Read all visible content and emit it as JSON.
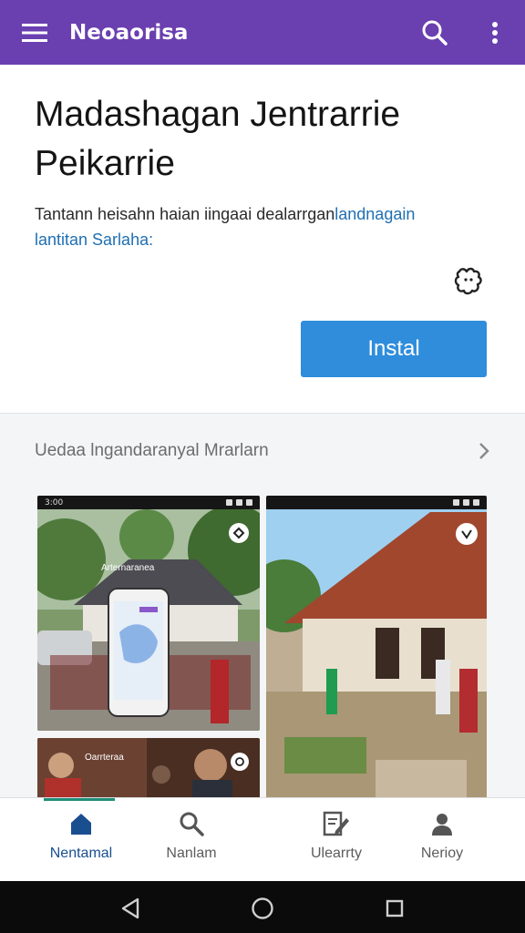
{
  "app_bar": {
    "title": "Neoaorisa",
    "menu_icon": "menu-icon",
    "search_icon": "search-icon",
    "more_icon": "more-vert-icon",
    "color": "#6a3fb0"
  },
  "hero": {
    "title": "Madashagan Jentrarrie Peikarrie",
    "description_text": "Tantann heisahn haian iingaai dealarrgan",
    "description_link": "landnagain lantitan Sarlaha:",
    "badge_icon": "puzzle-badge-icon",
    "install_label": "Instal",
    "install_color": "#2f8ddc"
  },
  "section": {
    "title": "Uedaa lngandaranyal Mrarlarn",
    "chevron_icon": "chevron-right-icon"
  },
  "screenshots": [
    {
      "label": "village-gathering-phone-screenshot",
      "status_time": "3:00",
      "overlay_sign": "Arternaranea",
      "badge_icon": "nfc-icon"
    },
    {
      "label": "village-house-market-screenshot",
      "badge_icon": "shield-check-icon"
    },
    {
      "label": "people-portraits-screenshot",
      "overlay_sign": "Oarrteraa",
      "badge_icon": "share-icon"
    }
  ],
  "bottom_nav": {
    "indicator_color": "#1e8f78",
    "items": [
      {
        "label": "Nentamal",
        "icon": "home-icon",
        "active": true
      },
      {
        "label": "Nanlam",
        "icon": "search-icon",
        "active": false
      },
      {
        "label": "Ulearrty",
        "icon": "edit-document-icon",
        "active": false
      },
      {
        "label": "Nerioy",
        "icon": "person-icon",
        "active": false
      }
    ]
  },
  "system_nav": {
    "back_icon": "back-triangle-icon",
    "home_icon": "home-circle-icon",
    "recents_icon": "recents-square-icon"
  }
}
